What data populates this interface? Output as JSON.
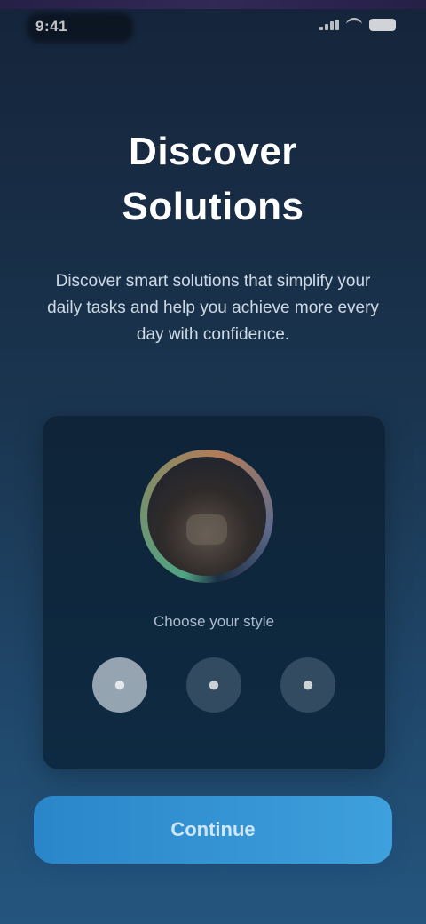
{
  "status_bar": {
    "time": "9:41",
    "icons": [
      "signal-icon",
      "wifi-icon",
      "battery-icon"
    ]
  },
  "header": {
    "title_line1": "Discover",
    "title_line2": "Solutions"
  },
  "intro": {
    "text": "Discover smart solutions that simplify your daily tasks and help you achieve more every day with confidence."
  },
  "card": {
    "caption": "Choose your style",
    "options": [
      {
        "icon": "circle-option-icon",
        "selected": true
      },
      {
        "icon": "circle-option-icon",
        "selected": false
      },
      {
        "icon": "circle-option-icon",
        "selected": false
      }
    ]
  },
  "cta": {
    "label": "Continue"
  },
  "colors": {
    "background_top": "#15243a",
    "background_bottom": "#24557e",
    "card": "#0f2438",
    "accent": "#3ea0dd"
  }
}
